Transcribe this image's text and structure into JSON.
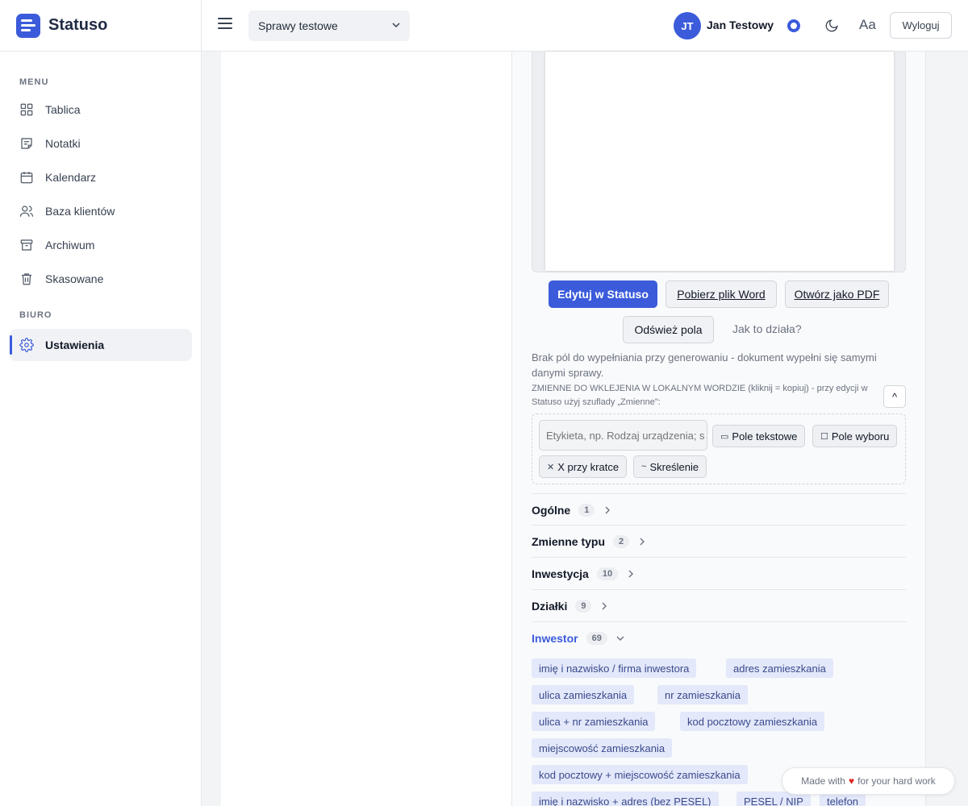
{
  "brand": {
    "name": "Statuso"
  },
  "sidebar": {
    "menu_label": "MENU",
    "office_label": "BIURO",
    "items": [
      {
        "label": "Tablica",
        "icon": "dashboard-icon"
      },
      {
        "label": "Notatki",
        "icon": "notes-icon"
      },
      {
        "label": "Kalendarz",
        "icon": "calendar-icon"
      },
      {
        "label": "Baza klientów",
        "icon": "users-icon"
      },
      {
        "label": "Archiwum",
        "icon": "archive-icon"
      },
      {
        "label": "Skasowane",
        "icon": "trash-icon"
      }
    ],
    "settings": {
      "label": "Ustawienia",
      "icon": "gear-icon",
      "active": true
    }
  },
  "topbar": {
    "case_select": "Sprawy testowe",
    "user_initials": "JT",
    "user_name": "Jan Testowy",
    "font_toggle": "Aa",
    "logout": "Wyloguj"
  },
  "document": {
    "edit_button": "Edytuj w Statuso",
    "word_button": "Pobierz plik Word",
    "pdf_button": "Otwórz jako PDF",
    "refresh_button": "Odśwież pola",
    "help_link": "Jak to działa?",
    "info_text": "Brak pól do wypełniania przy generowaniu - dokument wypełni się samymi danymi sprawy.",
    "vars_text": "ZMIENNE DO WKLEJENIA W LOKALNYM WORDZIE (kliknij = kopiuj) - przy edycji w Statuso użyj szuflady „Zmienne\":",
    "collapse": "^"
  },
  "field_builder": {
    "label_placeholder": "Etykieta, np. Rodzaj urządzenia; s",
    "text_field": "Pole tekstowe",
    "choice_field": "Pole wyboru",
    "checkbox_x": "X przy kratce",
    "strike": "Skreślenie"
  },
  "groups": [
    {
      "name": "Ogólne",
      "count": "1",
      "open": false
    },
    {
      "name": "Zmienne typu",
      "count": "2",
      "open": false
    },
    {
      "name": "Inwestycja",
      "count": "10",
      "open": false
    },
    {
      "name": "Działki",
      "count": "9",
      "open": false
    },
    {
      "name": "Inwestor",
      "count": "69",
      "open": true
    }
  ],
  "investor_vars": [
    "imię i nazwisko / firma inwestora",
    "adres zamieszkania",
    "ulica zamieszkania",
    "nr zamieszkania",
    "ulica + nr zamieszkania",
    "kod pocztowy zamieszkania",
    "miejscowość zamieszkania",
    "kod pocztowy + miejscowość zamieszkania",
    "imię i nazwisko + adres (bez PESEL)",
    "PESEL / NIP",
    "telefon"
  ],
  "footer": {
    "made_with": "Made with",
    "for_work": "for your hard work"
  },
  "colors": {
    "accent": "#3b5bdb",
    "tag_bg": "#e3e8fa",
    "heart": "#dc2626"
  }
}
